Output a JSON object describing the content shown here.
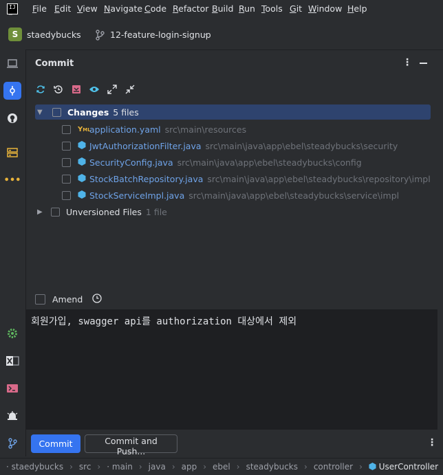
{
  "menu": {
    "items": [
      {
        "ul": "F",
        "rest": "ile"
      },
      {
        "ul": "E",
        "rest": "dit"
      },
      {
        "ul": "V",
        "rest": "iew"
      },
      {
        "ul": "N",
        "rest": "avigate"
      },
      {
        "ul": "C",
        "rest": "ode"
      },
      {
        "ul": "R",
        "rest": "efactor"
      },
      {
        "ul": "B",
        "rest": "uild"
      },
      {
        "ul": "R",
        "rest": "un"
      },
      {
        "ul": "T",
        "rest": "ools"
      },
      {
        "ul": "G",
        "rest": "it"
      },
      {
        "ul": "W",
        "rest": "indow"
      },
      {
        "ul": "H",
        "rest": "elp"
      }
    ]
  },
  "toolbar": {
    "project_initial": "S",
    "project_name": "staedybucks",
    "branch_name": "12-feature-login-signup"
  },
  "commit_panel": {
    "title": "Commit",
    "changes": {
      "label": "Changes",
      "count": "5 files",
      "files": [
        {
          "name": "application.yaml",
          "path": "src\\main\\resources",
          "icon": "yaml-icon"
        },
        {
          "name": "JwtAuthorizationFilter.java",
          "path": "src\\main\\java\\app\\ebel\\steadybucks\\security",
          "icon": "java-class-icon"
        },
        {
          "name": "SecurityConfig.java",
          "path": "src\\main\\java\\app\\ebel\\steadybucks\\config",
          "icon": "java-class-icon"
        },
        {
          "name": "StockBatchRepository.java",
          "path": "src\\main\\java\\app\\ebel\\steadybucks\\repository\\impl",
          "icon": "java-class-icon"
        },
        {
          "name": "StockServiceImpl.java",
          "path": "src\\main\\java\\app\\ebel\\steadybucks\\service\\impl",
          "icon": "java-class-icon"
        }
      ]
    },
    "unversioned": {
      "label": "Unversioned Files",
      "count": "1 file"
    },
    "amend_label": "Amend",
    "message": "회원가입, swagger api를 authorization 대상에서 제외",
    "commit_button": "Commit",
    "commit_push_button": "Commit and Push..."
  },
  "statusbar": {
    "breadcrumbs": [
      "staedybucks",
      "src",
      "main",
      "java",
      "app",
      "ebel",
      "steadybucks",
      "controller",
      "UserController"
    ]
  },
  "colors": {
    "accent": "#3574f0",
    "selection": "#2e436e",
    "file_name": "#6fa3e8"
  }
}
